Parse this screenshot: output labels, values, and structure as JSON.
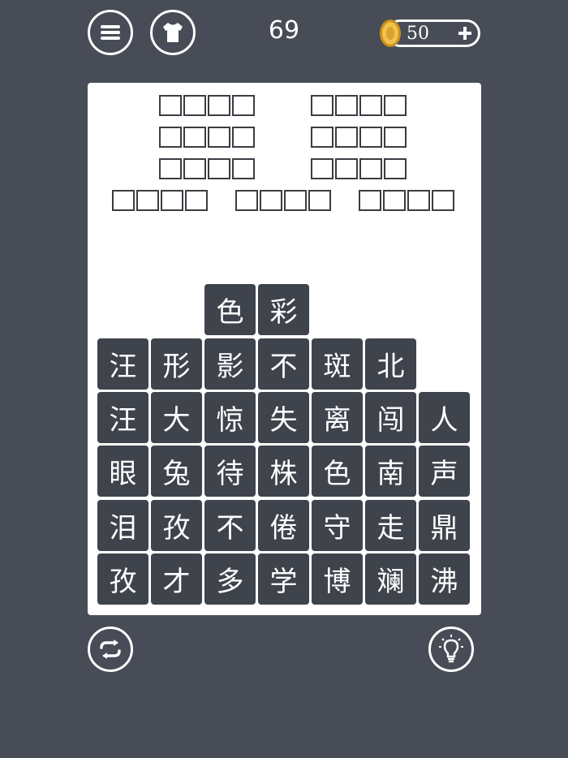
{
  "header": {
    "level": "69",
    "coins": "50",
    "icons": {
      "menu": "menu-icon",
      "skin": "shirt-icon",
      "coin": "coin-icon",
      "add": "plus-icon"
    }
  },
  "answer_slots": {
    "rows": [
      {
        "groups": 2,
        "letters_per_group": 4
      },
      {
        "groups": 2,
        "letters_per_group": 4
      },
      {
        "groups": 2,
        "letters_per_group": 4
      },
      {
        "groups": 3,
        "letters_per_group": 4
      }
    ]
  },
  "tiles": {
    "row1": [
      "",
      "",
      "色",
      "彩",
      "",
      "",
      ""
    ],
    "row2": [
      "汪",
      "形",
      "影",
      "不",
      "斑",
      "北",
      ""
    ],
    "row3": [
      "汪",
      "大",
      "惊",
      "失",
      "离",
      "闯",
      "人"
    ],
    "row4": [
      "眼",
      "兔",
      "待",
      "株",
      "色",
      "南",
      "声"
    ],
    "row5": [
      "泪",
      "孜",
      "不",
      "倦",
      "守",
      "走",
      "鼎"
    ],
    "row6": [
      "孜",
      "才",
      "多",
      "学",
      "博",
      "斓",
      "沸"
    ]
  },
  "footer": {
    "icons": {
      "shuffle": "shuffle-icon",
      "hint": "lightbulb-icon"
    }
  },
  "colors": {
    "background": "#474c56",
    "board": "#ffffff",
    "tile": "#3e434c",
    "coin": "#e8b43a"
  }
}
